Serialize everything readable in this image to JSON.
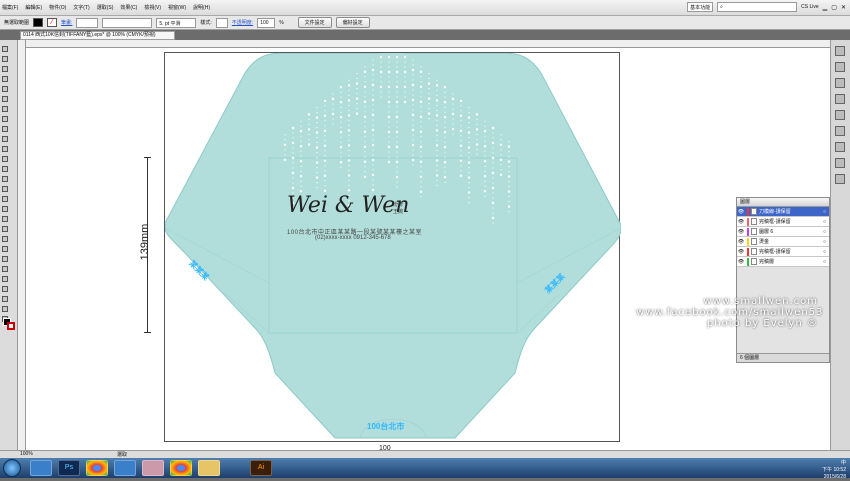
{
  "menubar": {
    "items": [
      "檔案(F)",
      "編輯(E)",
      "物件(O)",
      "文字(T)",
      "選取(S)",
      "效果(C)",
      "檢視(V)",
      "視窗(W)",
      "說明(H)"
    ],
    "workspace": "基本功能",
    "search_placeholder": "",
    "cs_live": "CS Live",
    "window_controls": [
      "minimize",
      "maximize",
      "close"
    ]
  },
  "controlbar": {
    "selection_label": "無選取範圍",
    "stroke_label": "筆畫:",
    "stroke_weight": "5. pt 平滑",
    "style_label": "樣式:",
    "opacity_label": "不透明度:",
    "opacity_value": "100",
    "opacity_unit": "%",
    "doc_setup_button": "文件設定",
    "prefs_button": "偏好設定"
  },
  "document_tab": "0114 西式10K信封(TIFFANY藍).eps* @ 100% (CMYK/預視)",
  "artboard": {
    "dimension_label": "139mm",
    "bottom_label": "100",
    "logo_text": "Wei & Wen",
    "logo_side_text": [
      "汾諺",
      "王婉"
    ],
    "address_lines": [
      "100台北市中正區某某路一段某號某某樓之某室",
      "(02)xxxx-xxxx    0912-345-678"
    ],
    "flap_texts": [
      "某某某",
      "某某某",
      "100台北市"
    ],
    "envelope_color": "#b1dedb",
    "text_color": "#2d7fd0"
  },
  "layers_panel": {
    "title": "圖層",
    "rows": [
      {
        "name": "刀模線-請保留",
        "color": "#ff3030",
        "selected": true
      },
      {
        "name": "完稿框-請保留",
        "color": "#ff6060",
        "selected": false
      },
      {
        "name": "圖層 6",
        "color": "#c040ff",
        "selected": false
      },
      {
        "name": "燙金",
        "color": "#ffd020",
        "selected": false
      },
      {
        "name": "完稿框-請保留",
        "color": "#ff3030",
        "selected": false
      },
      {
        "name": "完稿層",
        "color": "#30c040",
        "selected": false
      }
    ],
    "footer": "6 個圖層"
  },
  "watermark": {
    "lines": [
      "www.smallwen.com",
      "www.facebook.com/smallwen53",
      "photo by Evelyn ®"
    ]
  },
  "statusbar": {
    "zoom": "100%",
    "mode": "選取"
  },
  "taskbar": {
    "apps": [
      "ie-icon",
      "ps-icon",
      "chrome-icon",
      "ie-icon",
      "flower-icon",
      "chrome-icon",
      "folder-icon",
      "ai-icon"
    ],
    "ime": "中",
    "time": "下午 10:52",
    "date": "2015/6/28"
  }
}
